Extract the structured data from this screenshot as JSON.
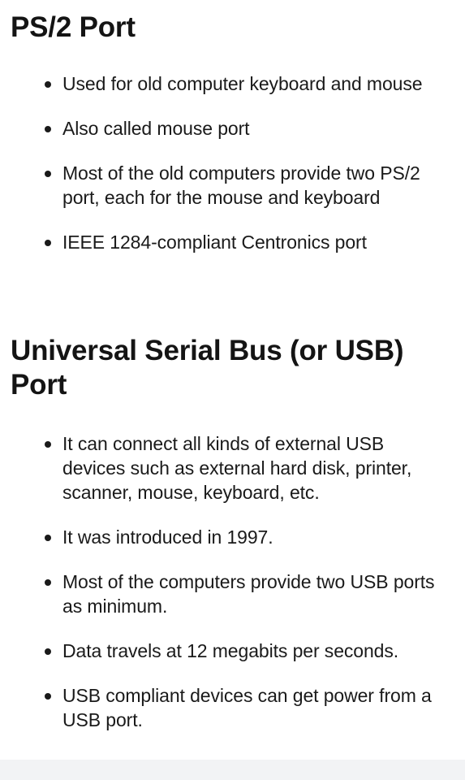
{
  "sections": [
    {
      "heading": "PS/2 Port",
      "items": [
        "Used for old computer keyboard and mouse",
        "Also called mouse port",
        "Most of the old computers provide two PS/2 port, each for the mouse and keyboard",
        "IEEE 1284-compliant Centronics port"
      ]
    },
    {
      "heading": "Universal Serial Bus (or USB) Port",
      "items": [
        "It can connect all kinds of external USB devices such as external hard disk, printer, scanner, mouse, keyboard, etc.",
        "It was introduced in 1997.",
        "Most of the computers provide two USB ports as minimum.",
        "Data travels at 12 megabits per seconds.",
        "USB compliant devices can get power from a USB port."
      ]
    }
  ]
}
